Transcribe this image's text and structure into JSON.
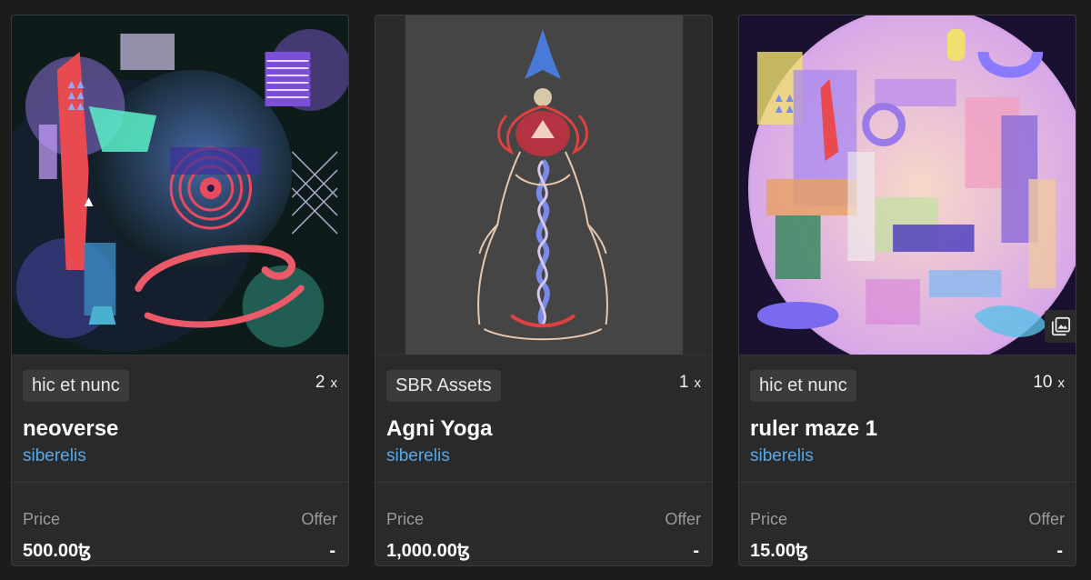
{
  "cards": [
    {
      "platform": "hic et nunc",
      "editions": "2",
      "editions_suffix": "x",
      "title": "neoverse",
      "artist": "siberelis",
      "price_label": "Price",
      "price": "500.00ꜩ",
      "offer_label": "Offer",
      "offer": "-"
    },
    {
      "platform": "SBR Assets",
      "editions": "1",
      "editions_suffix": "x",
      "title": "Agni Yoga",
      "artist": "siberelis",
      "price_label": "Price",
      "price": "1,000.00ꜩ",
      "offer_label": "Offer",
      "offer": "-"
    },
    {
      "platform": "hic et nunc",
      "editions": "10",
      "editions_suffix": "x",
      "title": "ruler maze 1",
      "artist": "siberelis",
      "price_label": "Price",
      "price": "15.00ꜩ",
      "offer_label": "Offer",
      "offer": "-"
    }
  ],
  "colors": {
    "background": "#1c1c1c",
    "card": "#2a2a2a",
    "tag": "#3b3b3b",
    "artist_link": "#5aa8e8",
    "muted_label": "#9a9a9a"
  },
  "icons": {
    "gallery": "gallery-icon"
  }
}
